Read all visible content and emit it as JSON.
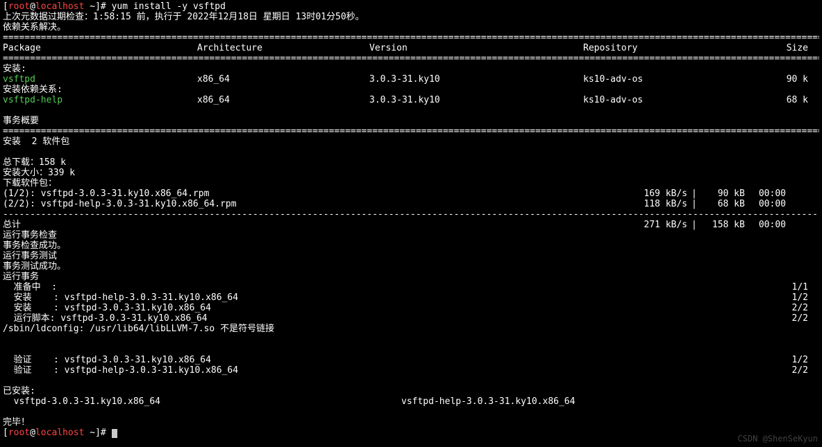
{
  "prompt": {
    "open": "[",
    "user": "root",
    "at": "@",
    "host": "localhost",
    "tilde": " ~",
    "close": "]# ",
    "cmd": "yum install -y vsftpd"
  },
  "lastCheck": "上次元数据过期检查：1:58:15 前，执行于 2022年12月18日 星期日 13时01分50秒。",
  "depsResolved": "依赖关系解决。",
  "headers": {
    "package": "Package",
    "arch": "Architecture",
    "version": "Version",
    "repo": "Repository",
    "size": "Size"
  },
  "sections": {
    "installing": "安装:",
    "deps": "安装依赖关系:",
    "summary": "事务概要"
  },
  "packages": [
    {
      "name": " vsftpd",
      "arch": "x86_64",
      "version": "3.0.3-31.ky10",
      "repo": "ks10-adv-os",
      "size": "90 k"
    },
    {
      "name": " vsftpd-help",
      "arch": "x86_64",
      "version": "3.0.3-31.ky10",
      "repo": "ks10-adv-os",
      "size": "68 k"
    }
  ],
  "summary": {
    "count": "安装  2 软件包",
    "totalDl": "总下载：158 k",
    "installedSize": "安装大小：339 k",
    "downloading": "下载软件包："
  },
  "downloads": [
    {
      "label": "(1/2): vsftpd-3.0.3-31.ky10.x86_64.rpm",
      "speed": "169 kB/s",
      "bar": "|",
      "size": "90 kB",
      "time": "00:00"
    },
    {
      "label": "(2/2): vsftpd-help-3.0.3-31.ky10.x86_64.rpm",
      "speed": "118 kB/s",
      "bar": "|",
      "size": "68 kB",
      "time": "00:00"
    }
  ],
  "total": {
    "label": "总计",
    "speed": "271 kB/s",
    "bar": "|",
    "size": "158 kB",
    "time": "00:00"
  },
  "trans": {
    "runCheck": "运行事务检查",
    "checkOk": "事务检查成功。",
    "runTest": "运行事务测试",
    "testOk": "事务测试成功。",
    "run": "运行事务"
  },
  "steps": [
    {
      "text": "  准备中  :",
      "count": "1/1"
    },
    {
      "text": "  安装    : vsftpd-help-3.0.3-31.ky10.x86_64",
      "count": "1/2"
    },
    {
      "text": "  安装    : vsftpd-3.0.3-31.ky10.x86_64",
      "count": "2/2"
    },
    {
      "text": "  运行脚本: vsftpd-3.0.3-31.ky10.x86_64",
      "count": "2/2"
    }
  ],
  "ldconfig": "/sbin/ldconfig: /usr/lib64/libLLVM-7.so 不是符号链接",
  "verifySteps": [
    {
      "text": "  验证    : vsftpd-3.0.3-31.ky10.x86_64",
      "count": "1/2"
    },
    {
      "text": "  验证    : vsftpd-help-3.0.3-31.ky10.x86_64",
      "count": "2/2"
    }
  ],
  "installed": {
    "header": "已安装:",
    "pkg1": "  vsftpd-3.0.3-31.ky10.x86_64",
    "pkg2": "vsftpd-help-3.0.3-31.ky10.x86_64"
  },
  "complete": "完毕！",
  "watermark": "CSDN @ShenSeKyun",
  "rules": {
    "eq": "================================================================================================================================================================",
    "dash": "--------------------------------------------------------------------------------------------------------------------------------------------------------"
  }
}
